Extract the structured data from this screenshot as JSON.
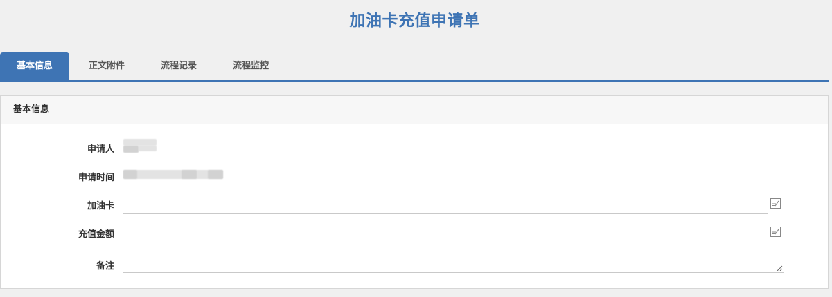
{
  "page": {
    "title": "加油卡充值申请单"
  },
  "tabs": [
    {
      "label": "基本信息",
      "active": true
    },
    {
      "label": "正文附件",
      "active": false
    },
    {
      "label": "流程记录",
      "active": false
    },
    {
      "label": "流程监控",
      "active": false
    }
  ],
  "panel": {
    "title": "基本信息",
    "fields": {
      "applicant": {
        "label": "申请人"
      },
      "apply_time": {
        "label": "申请时间"
      },
      "fuel_card": {
        "label": "加油卡",
        "value": "",
        "icon": "edit-icon"
      },
      "amount": {
        "label": "充值金额",
        "value": "",
        "icon": "edit-icon"
      },
      "remark": {
        "label": "备注",
        "value": ""
      }
    }
  },
  "colors": {
    "accent": "#3e74b4",
    "background": "#f0f0f0",
    "panel_header": "#f7f7f7"
  }
}
